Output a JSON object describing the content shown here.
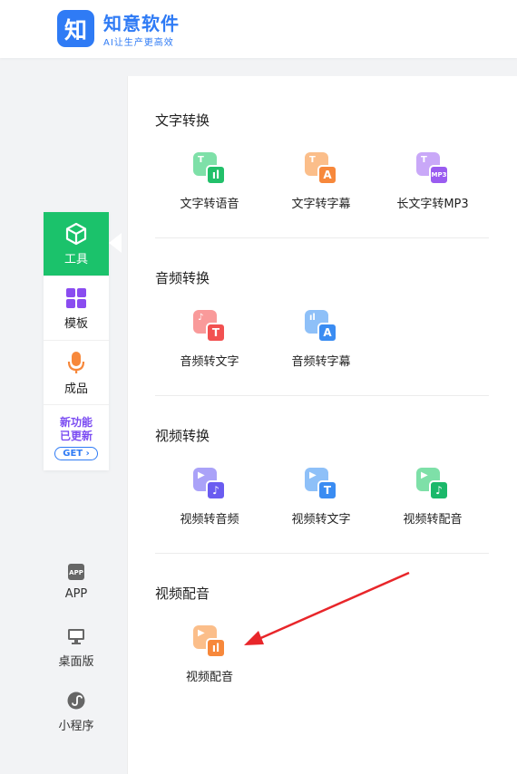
{
  "header": {
    "logo_char": "知",
    "brand_name": "知意软件",
    "brand_slogan": "AI让生产更高效"
  },
  "sidebar": {
    "items": [
      {
        "label": "工具",
        "icon": "cube-icon",
        "active": true
      },
      {
        "label": "模板",
        "icon": "grid-icon"
      },
      {
        "label": "成品",
        "icon": "microphone-icon"
      }
    ],
    "promo": {
      "line1": "新功能",
      "line2": "已更新",
      "button": "GET ›"
    },
    "bottom_links": [
      {
        "label": "APP",
        "icon": "app-icon"
      },
      {
        "label": "桌面版",
        "icon": "monitor-icon"
      },
      {
        "label": "小程序",
        "icon": "mini-program-icon"
      }
    ]
  },
  "sections": [
    {
      "title": "文字转换",
      "tools": [
        {
          "label": "文字转语音",
          "icon": "text-to-speech-icon",
          "back_glyph": "T",
          "front_glyph": "ıl",
          "color": "#22c06a"
        },
        {
          "label": "文字转字幕",
          "icon": "text-to-subtitle-icon",
          "back_glyph": "T",
          "front_glyph": "A",
          "color": "#f7883b"
        },
        {
          "label": "长文字转MP3",
          "icon": "text-to-mp3-icon",
          "back_glyph": "T",
          "front_glyph": "MP3",
          "color": "#9a5cf0"
        }
      ]
    },
    {
      "title": "音频转换",
      "tools": [
        {
          "label": "音频转文字",
          "icon": "audio-to-text-icon",
          "back_glyph": "♪",
          "front_glyph": "T",
          "color": "#f25151"
        },
        {
          "label": "音频转字幕",
          "icon": "audio-to-subtitle-icon",
          "back_glyph": "ıl",
          "front_glyph": "A",
          "color": "#3a8cf2"
        }
      ]
    },
    {
      "title": "视频转换",
      "tools": [
        {
          "label": "视频转音频",
          "icon": "video-to-audio-icon",
          "back_glyph": "▶",
          "front_glyph": "♪",
          "color": "#6a5cf0"
        },
        {
          "label": "视频转文字",
          "icon": "video-to-text-icon",
          "back_glyph": "▶",
          "front_glyph": "T",
          "color": "#3a8cf2"
        },
        {
          "label": "视频转配音",
          "icon": "video-to-dubbing-icon",
          "back_glyph": "▶",
          "front_glyph": "♪",
          "color": "#1bb86a"
        }
      ]
    },
    {
      "title": "视频配音",
      "tools": [
        {
          "label": "视频配音",
          "icon": "video-dubbing-icon",
          "back_glyph": "▶",
          "front_glyph": "ıl",
          "color": "#f7883b"
        }
      ]
    }
  ]
}
